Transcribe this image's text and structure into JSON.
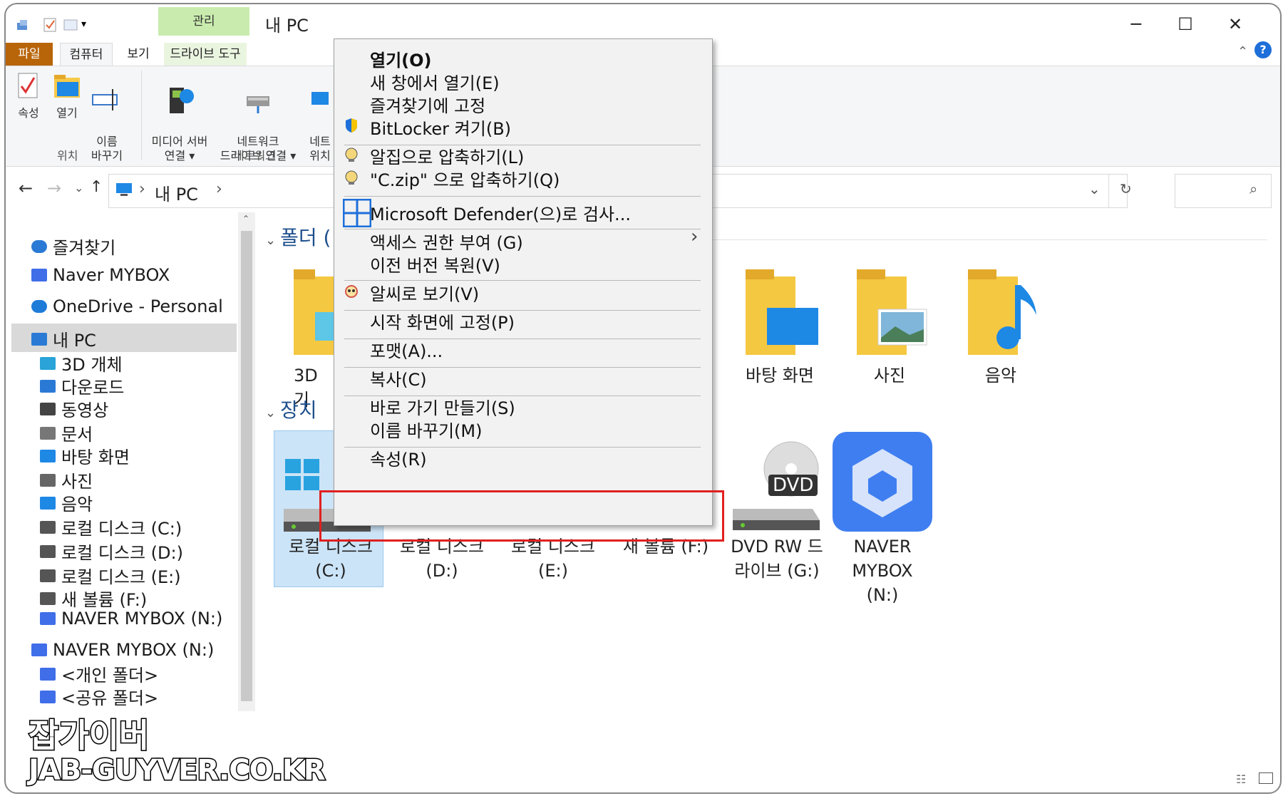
{
  "window": {
    "title": "내 PC",
    "contextual_tab_group": "관리",
    "tabs": [
      "파일",
      "컴퓨터",
      "보기",
      "드라이브 도구"
    ],
    "controls": {
      "minimize": "─",
      "maximize": "☐",
      "close": "✕"
    },
    "help": "?"
  },
  "ribbon": {
    "location_group": {
      "label": "위치",
      "buttons": [
        "속성",
        "열기",
        "이름\n바꾸기"
      ]
    },
    "network_group": {
      "label": "네트워크",
      "buttons": [
        "미디어 서버\n연결 ▾",
        "네트워크\n드라이브 연결 ▾",
        "네트\n위치"
      ]
    }
  },
  "address_bar": {
    "crumb": "내 PC",
    "sep": "›"
  },
  "nav": {
    "items": [
      {
        "label": "즐겨찾기",
        "icon": "star-icon",
        "indent": false,
        "color": "#2a7ad5"
      },
      {
        "label": "Naver MYBOX",
        "icon": "mybox-icon",
        "indent": false,
        "color": "#3f6ee8"
      },
      {
        "label": "OneDrive - Personal",
        "icon": "cloud-icon",
        "indent": false,
        "color": "#1f7bd8"
      },
      {
        "label": "내 PC",
        "icon": "computer-icon",
        "indent": false,
        "color": "#2a7ad5",
        "selected": true
      },
      {
        "label": "3D 개체",
        "icon": "cube-icon",
        "indent": true,
        "color": "#29a3d8"
      },
      {
        "label": "다운로드",
        "icon": "download-icon",
        "indent": true,
        "color": "#2a7ad5"
      },
      {
        "label": "동영상",
        "icon": "video-icon",
        "indent": true,
        "color": "#444444"
      },
      {
        "label": "문서",
        "icon": "document-icon",
        "indent": true,
        "color": "#777777"
      },
      {
        "label": "바탕 화면",
        "icon": "desktop-icon",
        "indent": true,
        "color": "#1e88e5"
      },
      {
        "label": "사진",
        "icon": "picture-icon",
        "indent": true,
        "color": "#666666"
      },
      {
        "label": "음악",
        "icon": "music-icon",
        "indent": true,
        "color": "#1e88e5"
      },
      {
        "label": "로컬 디스크 (C:)",
        "icon": "drive-icon",
        "indent": true,
        "color": "#555555"
      },
      {
        "label": "로컬 디스크 (D:)",
        "icon": "drive-icon",
        "indent": true,
        "color": "#555555"
      },
      {
        "label": "로컬 디스크 (E:)",
        "icon": "drive-icon",
        "indent": true,
        "color": "#555555"
      },
      {
        "label": "새 볼륨 (F:)",
        "icon": "drive-icon",
        "indent": true,
        "color": "#555555"
      },
      {
        "label": "NAVER MYBOX (N:)",
        "icon": "mybox-icon",
        "indent": true,
        "color": "#3f6ee8"
      },
      {
        "label": "NAVER MYBOX (N:)",
        "icon": "mybox-icon",
        "indent": false,
        "color": "#3f6ee8"
      },
      {
        "label": "<개인 폴더>",
        "icon": "mybox-folder-icon",
        "indent": true,
        "color": "#3f6ee8"
      },
      {
        "label": "<공유 폴더>",
        "icon": "mybox-folder-icon",
        "indent": true,
        "color": "#3f6ee8"
      }
    ]
  },
  "content": {
    "folders_header": "폴더 (",
    "devices_header": "장치",
    "folders": [
      {
        "label": "3D 기"
      },
      {
        "label": "바탕 화면"
      },
      {
        "label": "사진"
      },
      {
        "label": "음악"
      }
    ],
    "devices": [
      {
        "label": "로컬 디스크\n(C:)",
        "selected": true
      },
      {
        "label": "로컬 디스크\n(D:)"
      },
      {
        "label": "로컬 디스크\n(E:)"
      },
      {
        "label": "새 볼륨 (F:)"
      },
      {
        "label": "DVD RW 드\n라이브 (G:)"
      },
      {
        "label": "NAVER\nMYBOX\n(N:)"
      }
    ],
    "dvd_badge": "DVD"
  },
  "context_menu": {
    "items": [
      {
        "label": "열기(O)",
        "bold": true,
        "icon": ""
      },
      {
        "label": "새 창에서 열기(E)",
        "icon": ""
      },
      {
        "label": "즐겨찾기에 고정",
        "icon": ""
      },
      {
        "label": "BitLocker 켜기(B)",
        "icon": "shield-icon"
      },
      {
        "label": "알집으로 압축하기(L)",
        "icon": "alzip-icon"
      },
      {
        "label": "\"C.zip\" 으로 압축하기(Q)",
        "icon": "alzip-icon"
      },
      {
        "label": "Microsoft Defender(으)로 검사...",
        "icon": "defender-icon"
      },
      {
        "label": "액세스 권한 부여 (G)",
        "icon": "",
        "submenu": true
      },
      {
        "label": "이전 버전 복원(V)",
        "icon": ""
      },
      {
        "label": "알씨로 보기(V)",
        "icon": "alsee-icon"
      },
      {
        "label": "시작 화면에 고정(P)",
        "icon": ""
      },
      {
        "label": "포맷(A)...",
        "icon": ""
      },
      {
        "label": "복사(C)",
        "icon": ""
      },
      {
        "label": "바로 가기 만들기(S)",
        "icon": ""
      },
      {
        "label": "이름 바꾸기(M)",
        "icon": ""
      },
      {
        "label": "속성(R)",
        "icon": "",
        "highlighted": true
      }
    ],
    "submenu_arrow": "›"
  },
  "watermark": {
    "line1": "잡가이버",
    "line2": "JAB-GUYVER.CO.KR"
  }
}
